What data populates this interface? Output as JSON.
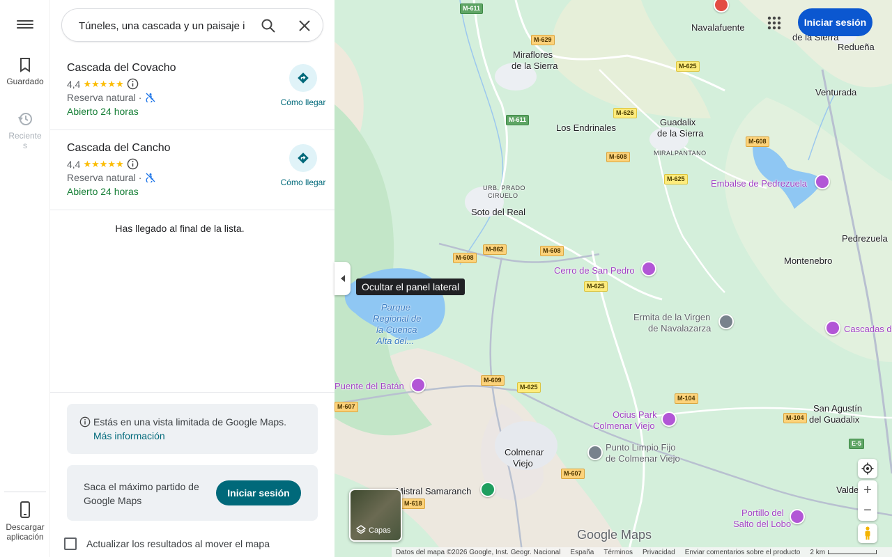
{
  "rail": {
    "saved_label": "Guardado",
    "recent_label_1": "Reciente",
    "recent_label_2": "s",
    "download_label_1": "Descargar",
    "download_label_2": "aplicación"
  },
  "search": {
    "value": "Túneles, una cascada y un paisaje i",
    "placeholder": ""
  },
  "results": [
    {
      "name": "Cascada del Covacho",
      "rating": "4,4",
      "stars": "★★★★★",
      "type": "Reserva natural ·",
      "hours": "Abierto 24 horas",
      "directions_label": "Cómo llegar"
    },
    {
      "name": "Cascada del Cancho",
      "rating": "4,4",
      "stars": "★★★★★",
      "type": "Reserva natural ·",
      "hours": "Abierto 24 horas",
      "directions_label": "Cómo llegar"
    }
  ],
  "end_of_list": "Has llegado al final de la lista.",
  "limited_view": {
    "text": "Estás en una vista limitada de Google Maps.",
    "link": "Más información"
  },
  "signin_card": {
    "text": "Saca el máximo partido de Google Maps",
    "button": "Iniciar sesión"
  },
  "update_on_move": "Actualizar los resultados al mover el mapa",
  "tooltip": "Ocultar el panel lateral",
  "top_signin": "Iniciar sesión",
  "layers_label": "Capas",
  "logo": "Google Maps",
  "footer": {
    "data": "Datos del mapa ©2026 Google, Inst. Geogr. Nacional",
    "country": "España",
    "terms": "Términos",
    "privacy": "Privacidad",
    "feedback": "Enviar comentarios sobre el producto",
    "scale": "2 km"
  },
  "map": {
    "places": {
      "navalafuente": "Navalafuente",
      "delasierra_top": "de la Sierra",
      "reduena": "Redueña",
      "miraflores": "Miraflores",
      "miraflores2": "de la Sierra",
      "venturada": "Venturada",
      "los_endrinales": "Los Endrinales",
      "guadalix": "Guadalix",
      "guadalix2": "de la Sierra",
      "miralpantano": "MIRALPANTANO",
      "urb_prado": "URB. PRADO",
      "ciruelo": "CIRUELO",
      "soto": "Soto del Real",
      "pedrezuela": "Pedrezuela",
      "montenebro": "Montenebro",
      "parque1": "Parque",
      "parque2": "Regional de",
      "parque3": "la Cuenca",
      "parque4": "Alta del...",
      "colmenar1": "Colmenar",
      "colmenar2": "Viejo",
      "san_agustin1": "San Agustín",
      "san_agustin2": "del Guadalix",
      "valdelagu": "Valdelagu"
    },
    "pois": {
      "embalse": "Embalse de Pedrezuela",
      "cerro": "Cerro de San Pedro",
      "ermita1": "Ermita de la Virgen",
      "ermita2": "de Navalazarza",
      "cascadas": "Cascadas d",
      "puente": "Puente del Batán",
      "ocius1": "Ocius Park",
      "ocius2": "Colmenar Viejo",
      "punto1": "Punto Limpio Fijo",
      "punto2": "de Colmenar Viejo",
      "mistral": "Mistral Samaranch",
      "portillo1": "Portillo del",
      "portillo2": "Salto del Lobo"
    },
    "roads": {
      "m611a": "M-611",
      "m629": "M-629",
      "m625a": "M-625",
      "m611b": "M-611",
      "m626": "M-626",
      "m608a": "M-608",
      "m608b": "M-608",
      "m625b": "M-625",
      "m862": "M-862",
      "m608c": "M-608",
      "m608d": "M-608",
      "m625c": "M-625",
      "m609": "M-609",
      "m625d": "M-625",
      "m104a": "M-104",
      "m104b": "M-104",
      "m607a": "M-607",
      "m607b": "M-607",
      "m618": "M-618",
      "e5": "E-5"
    }
  }
}
